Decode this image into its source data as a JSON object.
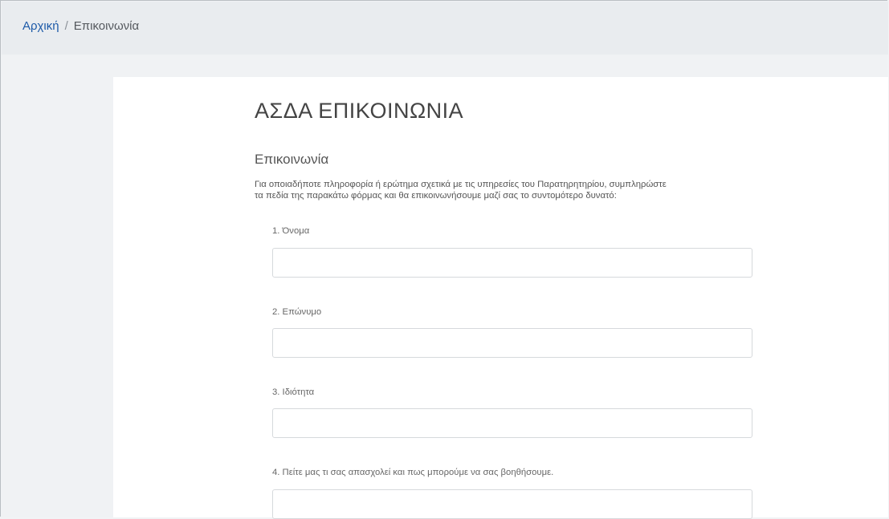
{
  "breadcrumb": {
    "home": "Αρχική",
    "separator": "/",
    "current": "Επικοινωνία"
  },
  "page": {
    "title": "ΑΣΔΑ ΕΠΙΚΟΙΝΩΝΙΑ",
    "section_title": "Επικοινωνία",
    "intro_line1": "Για οποιαδήποτε πληροφορία ή ερώτημα σχετικά με τις υπηρεσίες του Παρατηρητηρίου, συμπληρώστε",
    "intro_line2": "τα πεδία της παρακάτω φόρμας και θα επικοινωνήσουμε μαζί σας το συντομότερο δυνατό:"
  },
  "form": {
    "fields": [
      {
        "label": "1. Όνομα",
        "value": ""
      },
      {
        "label": "2. Επώνυμο",
        "value": ""
      },
      {
        "label": "3. Ιδιότητα",
        "value": ""
      },
      {
        "label": "4. Πείτε μας τι σας απασχολεί και πως μπορούμε να σας βοηθήσουμε.",
        "value": ""
      }
    ]
  },
  "colors": {
    "link": "#1d5aa8",
    "breadcrumb_bg": "#e9ecef",
    "page_bg": "#f0f2f4",
    "card_bg": "#ffffff"
  }
}
